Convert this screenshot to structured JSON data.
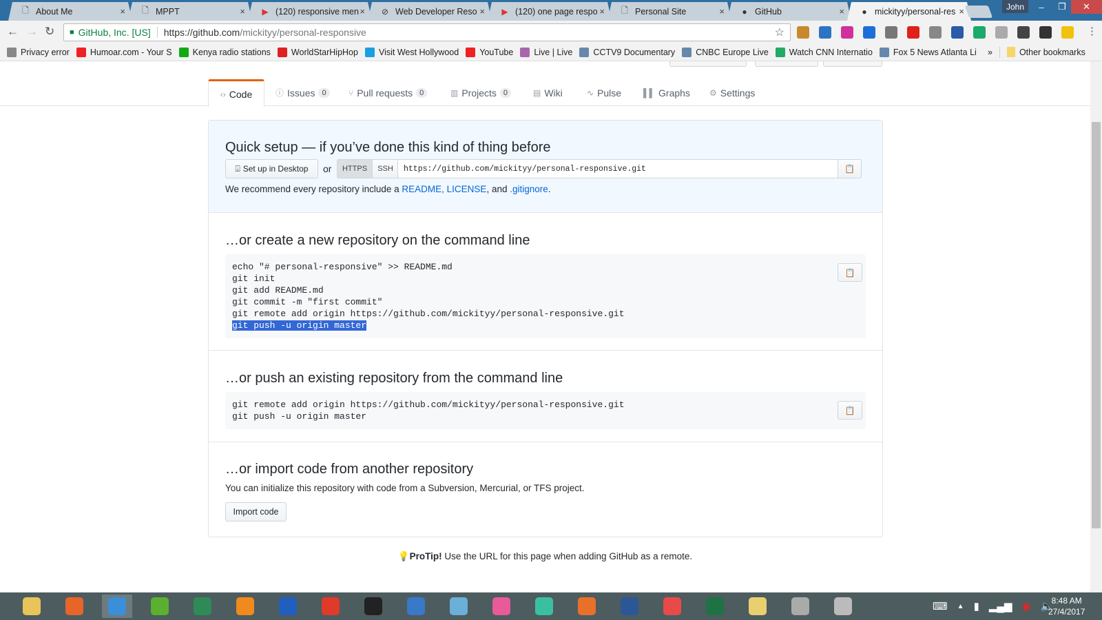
{
  "browser": {
    "tabs": [
      {
        "title": "About Me",
        "icon": "page-icon"
      },
      {
        "title": "MPPT",
        "icon": "page-icon"
      },
      {
        "title": "(120) responsive men",
        "icon": "youtube-icon"
      },
      {
        "title": "Web Developer Reso",
        "icon": "no-entry-icon"
      },
      {
        "title": "(120) one page respo",
        "icon": "youtube-icon"
      },
      {
        "title": "Personal Site",
        "icon": "page-icon"
      },
      {
        "title": "GitHub",
        "icon": "github-icon"
      },
      {
        "title": "mickityy/personal-res",
        "icon": "github-icon",
        "active": true
      }
    ],
    "close_glyph": "×",
    "user": "John",
    "secure_label": "GitHub, Inc. [US]",
    "url_host": "https://github.com",
    "url_path": "/mickityy/personal-responsive",
    "bookmarks": [
      {
        "label": "Privacy error",
        "color": "#888"
      },
      {
        "label": "Humoar.com - Your S",
        "color": "#e22"
      },
      {
        "label": "Kenya radio stations",
        "color": "#1a1"
      },
      {
        "label": "WorldStarHipHop",
        "color": "#d22"
      },
      {
        "label": "Visit West Hollywood",
        "color": "#1aa0e0"
      },
      {
        "label": "YouTube",
        "color": "#e22"
      },
      {
        "label": "Live | Live",
        "color": "#a6a"
      },
      {
        "label": "CCTV9 Documentary",
        "color": "#68a"
      },
      {
        "label": "CNBC Europe Live",
        "color": "#68a"
      },
      {
        "label": "Watch CNN Internatio",
        "color": "#2a6"
      },
      {
        "label": "Fox 5 News Atlanta Li",
        "color": "#68a"
      }
    ],
    "more": "»",
    "other_bookmarks": "Other bookmarks"
  },
  "repo_nav": [
    {
      "label": "Code",
      "icon": "code-icon",
      "selected": true
    },
    {
      "label": "Issues",
      "icon": "issue-icon",
      "count": "0"
    },
    {
      "label": "Pull requests",
      "icon": "pull-request-icon",
      "count": "0"
    },
    {
      "label": "Projects",
      "icon": "project-icon",
      "count": "0"
    },
    {
      "label": "Wiki",
      "icon": "book-icon"
    },
    {
      "label": "Pulse",
      "icon": "pulse-icon"
    },
    {
      "label": "Graphs",
      "icon": "graph-icon"
    },
    {
      "label": "Settings",
      "icon": "gear-icon"
    }
  ],
  "quick_setup": {
    "title": "Quick setup — if you’ve done this kind of thing before",
    "desktop_button": "Set up in Desktop",
    "or": "or",
    "https": "HTTPS",
    "ssh": "SSH",
    "clone_url": "https://github.com/mickityy/personal-responsive.git",
    "recommend_pre": "We recommend every repository include a ",
    "readme": "README",
    "license": "LICENSE",
    "and": ", and ",
    "gitignore": ".gitignore",
    "end": "."
  },
  "new_repo": {
    "title": "…or create a new repository on the command line",
    "lines": [
      "echo \"# personal-responsive\" >> README.md",
      "git init",
      "git add README.md",
      "git commit -m \"first commit\"",
      "git remote add origin https://github.com/mickityy/personal-responsive.git"
    ],
    "selected_line": "git push -u origin master"
  },
  "push_repo": {
    "title": "…or push an existing repository from the command line",
    "lines": [
      "git remote add origin https://github.com/mickityy/personal-responsive.git",
      "git push -u origin master"
    ]
  },
  "import_repo": {
    "title": "…or import code from another repository",
    "text": "You can initialize this repository with code from a Subversion, Mercurial, or TFS project.",
    "button": "Import code"
  },
  "protip": {
    "label": "ProTip!",
    "text": " Use the URL for this page when adding GitHub as a remote."
  },
  "taskbar": {
    "time": "8:48 AM",
    "date": "27/4/2017"
  }
}
